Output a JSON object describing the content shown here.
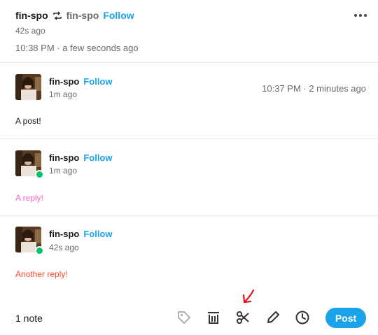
{
  "header": {
    "author": "fin-spo",
    "reblogged_from": "fin-spo",
    "follow_label": "Follow",
    "ago": "42s ago",
    "timestamp": "10:38 PM · a few seconds ago"
  },
  "trail": [
    {
      "name": "fin-spo",
      "follow_label": "Follow",
      "ago": "1m ago",
      "timestamp": "10:37 PM · 2 minutes ago",
      "text": "A post!",
      "text_color": "#1a1a1a"
    },
    {
      "name": "fin-spo",
      "follow_label": "Follow",
      "ago": "1m ago",
      "text": "A reply!",
      "text_color": "#ff62ce"
    },
    {
      "name": "fin-spo",
      "follow_label": "Follow",
      "ago": "42s ago",
      "text": "Another reply!",
      "text_color": "#ff4930"
    }
  ],
  "footer": {
    "notes": "1 note",
    "post_label": "Post"
  },
  "colors": {
    "accent": "#1aa3e8",
    "reblog_badge": "#00c46a",
    "annotation": "#e0131a"
  },
  "icons": [
    "reblog-icon",
    "more-icon",
    "tag-icon",
    "delete-icon",
    "scissors-icon",
    "edit-icon",
    "clock-icon",
    "annotation-arrow"
  ]
}
